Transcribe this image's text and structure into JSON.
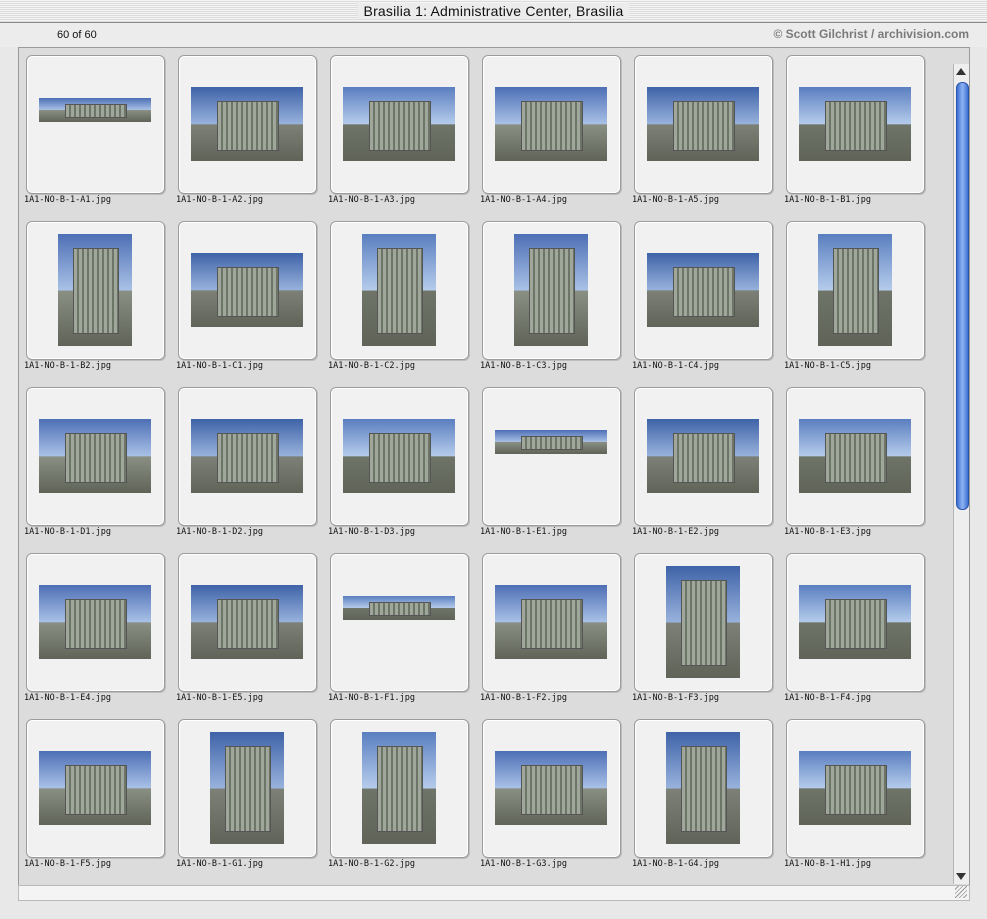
{
  "window": {
    "title": "Brasilia 1: Administrative Center, Brasilia"
  },
  "info": {
    "count": "60 of 60",
    "credit": "© Scott Gilchrist / archivision.com"
  },
  "thumbnails": [
    {
      "file": "1A1-NO-B-1-A1.jpg",
      "shape": "wide"
    },
    {
      "file": "1A1-NO-B-1-A2.jpg",
      "shape": "land"
    },
    {
      "file": "1A1-NO-B-1-A3.jpg",
      "shape": "land"
    },
    {
      "file": "1A1-NO-B-1-A4.jpg",
      "shape": "land"
    },
    {
      "file": "1A1-NO-B-1-A5.jpg",
      "shape": "land"
    },
    {
      "file": "1A1-NO-B-1-B1.jpg",
      "shape": "land"
    },
    {
      "file": "1A1-NO-B-1-B2.jpg",
      "shape": "port"
    },
    {
      "file": "1A1-NO-B-1-C1.jpg",
      "shape": "land"
    },
    {
      "file": "1A1-NO-B-1-C2.jpg",
      "shape": "port"
    },
    {
      "file": "1A1-NO-B-1-C3.jpg",
      "shape": "port"
    },
    {
      "file": "1A1-NO-B-1-C4.jpg",
      "shape": "land"
    },
    {
      "file": "1A1-NO-B-1-C5.jpg",
      "shape": "port"
    },
    {
      "file": "1A1-NO-B-1-D1.jpg",
      "shape": "land"
    },
    {
      "file": "1A1-NO-B-1-D2.jpg",
      "shape": "land"
    },
    {
      "file": "1A1-NO-B-1-D3.jpg",
      "shape": "land"
    },
    {
      "file": "1A1-NO-B-1-E1.jpg",
      "shape": "wide"
    },
    {
      "file": "1A1-NO-B-1-E2.jpg",
      "shape": "land"
    },
    {
      "file": "1A1-NO-B-1-E3.jpg",
      "shape": "land"
    },
    {
      "file": "1A1-NO-B-1-E4.jpg",
      "shape": "land"
    },
    {
      "file": "1A1-NO-B-1-E5.jpg",
      "shape": "land"
    },
    {
      "file": "1A1-NO-B-1-F1.jpg",
      "shape": "wide"
    },
    {
      "file": "1A1-NO-B-1-F2.jpg",
      "shape": "land"
    },
    {
      "file": "1A1-NO-B-1-F3.jpg",
      "shape": "port"
    },
    {
      "file": "1A1-NO-B-1-F4.jpg",
      "shape": "land"
    },
    {
      "file": "1A1-NO-B-1-F5.jpg",
      "shape": "land"
    },
    {
      "file": "1A1-NO-B-1-G1.jpg",
      "shape": "port"
    },
    {
      "file": "1A1-NO-B-1-G2.jpg",
      "shape": "port"
    },
    {
      "file": "1A1-NO-B-1-G3.jpg",
      "shape": "land"
    },
    {
      "file": "1A1-NO-B-1-G4.jpg",
      "shape": "port"
    },
    {
      "file": "1A1-NO-B-1-H1.jpg",
      "shape": "land"
    }
  ],
  "scrollbar": {
    "position_fraction": 0.0,
    "visible_fraction": 0.5
  },
  "colors": {
    "window_bg": "#e8e8e8",
    "tile_bg": "#f1f1f1",
    "scroll_accent": "#3b6fd4",
    "credit_text": "#7a7a7a"
  }
}
